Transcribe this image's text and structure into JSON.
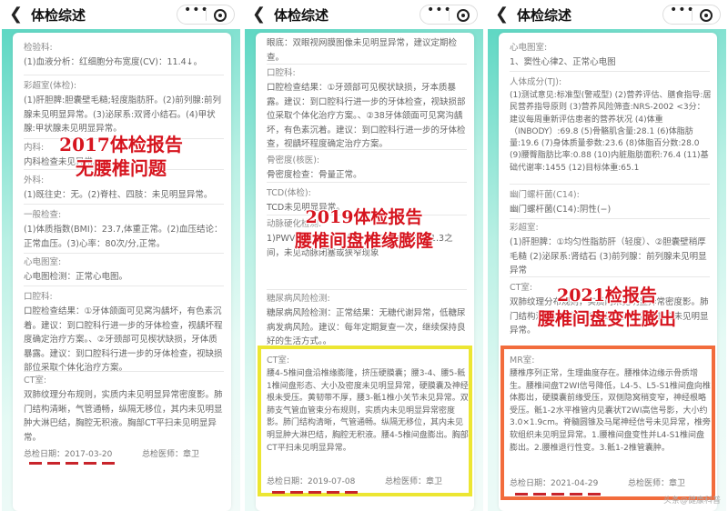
{
  "colors": {
    "teal": "#5dd7c3",
    "overlay_red": "#d6151f",
    "yellow_box": "#ece632",
    "orange_box": "#f26c3c"
  },
  "panels": [
    {
      "title": "体检综述",
      "overlay": [
        "2017体检报告",
        "无腰椎问题"
      ],
      "sections": [
        {
          "title": "检验科:",
          "body": "(1)血液分析：红细胞分布宽度(CV)：11.4↓。"
        },
        {
          "title": "彩超室(体检):",
          "body": "(1)肝胆脾:胆囊壁毛糙;轻度脂肪肝。(2)前列腺:前列腺未见明显异常。(3)泌尿系:双肾小结石。(4)甲状腺:甲状腺未见明显异常。"
        },
        {
          "title": "内科:",
          "body": "内科检查未见异常。"
        },
        {
          "title": "外科:",
          "body": "(1)既往史：无。(2)脊柱、四肢：未见明显异常。"
        },
        {
          "title": "一般检查:",
          "body": "(1)体质指数(BMI)：23.7,体重正常。(2)血压结论：正常血压。(3)心率：80次/分,正常。"
        },
        {
          "title": "心电图室:",
          "body": "心电图检测：正常心电图。"
        },
        {
          "title": "口腔科:",
          "body": "口腔检查结果：①牙体颌面可见窝沟龋坏，有色素沉着。建议：到口腔科行进一步的牙体检查，视龋坏程度确定治疗方案。、②牙颈部可见楔状缺损，牙体质暴露。建议：到口腔科行进一步的牙体检查，视缺损部位采取个体化治疗方案。"
        },
        {
          "title": "CT室:",
          "body": "双肺纹理分布规则，实质内未见明显异常密度影。肺门结构清晰，气管通畅，纵隔无移位，其内未见明显肿大淋巴结，胸腔无积液。胸部CT平扫未见明显异常。"
        }
      ],
      "footer": {
        "date": "总检日期：2017-03-20",
        "doctor": "总检医师：章卫"
      }
    },
    {
      "title": "体检综述",
      "overlay": [
        "2019体检报告",
        "腰椎间盘椎缘膨隆"
      ],
      "sections": [
        {
          "title": "",
          "body": "眼底：双眼视网膜图像未见明显异常，建议定期检查。"
        },
        {
          "title": "口腔科:",
          "body": "口腔检查结果：①牙颈部可见楔状缺损，牙本质暴露。建议：到口腔科行进一步的牙体检查，视缺损部位采取个体化治疗方案。、②38牙体颌面可见窝沟龋坏，有色素沉着。建议：到口腔科行进一步的牙体检查，视龋坏程度确定治疗方案。"
        },
        {
          "title": "骨密度(核医):",
          "body": "骨密度检查：骨量正常。"
        },
        {
          "title": "TCD(体检):",
          "body": "TCD未见明显异常。"
        },
        {
          "title": "动脉硬化检测:",
          "body": "1)PWV值：动脉弹性好。2)ABI值介于1.0-1.3之间，未见动脉闭塞或狭窄现象"
        },
        {
          "title": "糖尿病风险检测:",
          "body": "糖尿病风险检测：正常结果：无糖代谢异常，低糖尿病发病风险。建议：每年定期复查一次，继续保持良好的生活方式。。"
        },
        {
          "title": "CT室:",
          "body": "腰4-5椎间盘沿椎缘膨隆，挤压硬膜囊；腰3-4、腰5-骶1椎间盘形态、大小及密度未见明显异常，硬膜囊及神经根未受压。黄韧带不厚，腰3-骶1椎小关节未见异常。双肺支气管血管束分布规则，实质内未见明显异常密度影。肺门结构清晰，气管通畅。纵隔无移位，其内未见明显肿大淋巴结，胸腔无积液。腰4-5椎间盘膨出。胸部CT平扫未见明显异常。"
        }
      ],
      "footer": {
        "date": "总检日期：2019-07-08",
        "doctor": "总检医师：章卫"
      }
    },
    {
      "title": "体检综述",
      "overlay": [
        "2021检报告",
        "腰椎间盘变性膨出"
      ],
      "sections": [
        {
          "title": "心电图室:",
          "body": "1、窦性心律2、正常心电图"
        },
        {
          "title": "人体成分(TJ):",
          "body": "(1)测试意见:标准型(警戒型) (2)营养评估、膳食指导:居民营养指导原则 (3)营养风险筛查:NRS-2002 <3分：建议每周重新评估患者的营养状况 (4)体重（INBODY）:69.8 (5)骨骼肌含量:28.1 (6)体脂肪量:19.6 (7)身体质量参数:23.6 (8)体脂百分数:28.0 (9)腰臀脂肪比率:0.88 (10)内脏脂肪面积:76.4 (11)基础代谢率:1455 (12)目标体重:65.1"
        },
        {
          "title": "幽门螺杆菌(C14):",
          "body": "幽门螺杆菌(C14):阴性(−)"
        },
        {
          "title": "彩超室:",
          "body": "(1)肝胆脾：①均匀性脂肪肝（轻度）、②胆囊壁稍厚毛糙 (2)泌尿系:肾结石 (3)前列腺：前列腺未见明显异常"
        },
        {
          "title": "CT室:",
          "body": "双肺纹理分布规则，实质内未见明显异常密度影。肺门结构清晰，气管通畅，纵隔无移位，其内未见明显异常。"
        },
        {
          "title": "MR室:",
          "body": "腰椎序列正常，生理曲度存在。腰椎体边缘示骨质增生。腰椎间盘T2WI信号降低，L4-5、L5-S1椎间盘向椎体膨出，硬膜囊前缘受压，双侧隐窝稍变窄，神经根略受压。骶1-2水平椎管内见囊状T2WI高信号影，大小约3.0×1.9cm。脊髓圆锥及马尾神经信号未见异常，椎旁软组织未见明显异常。1.腰椎间盘变性并L4-S1椎间盘膨出。2.腰椎退行性变。3.骶1-2椎管囊肿。"
        }
      ],
      "footer": {
        "date": "总检日期：2021-04-29",
        "doctor": "总检医师：章卫"
      },
      "watermark": "头条@健康科普"
    }
  ]
}
